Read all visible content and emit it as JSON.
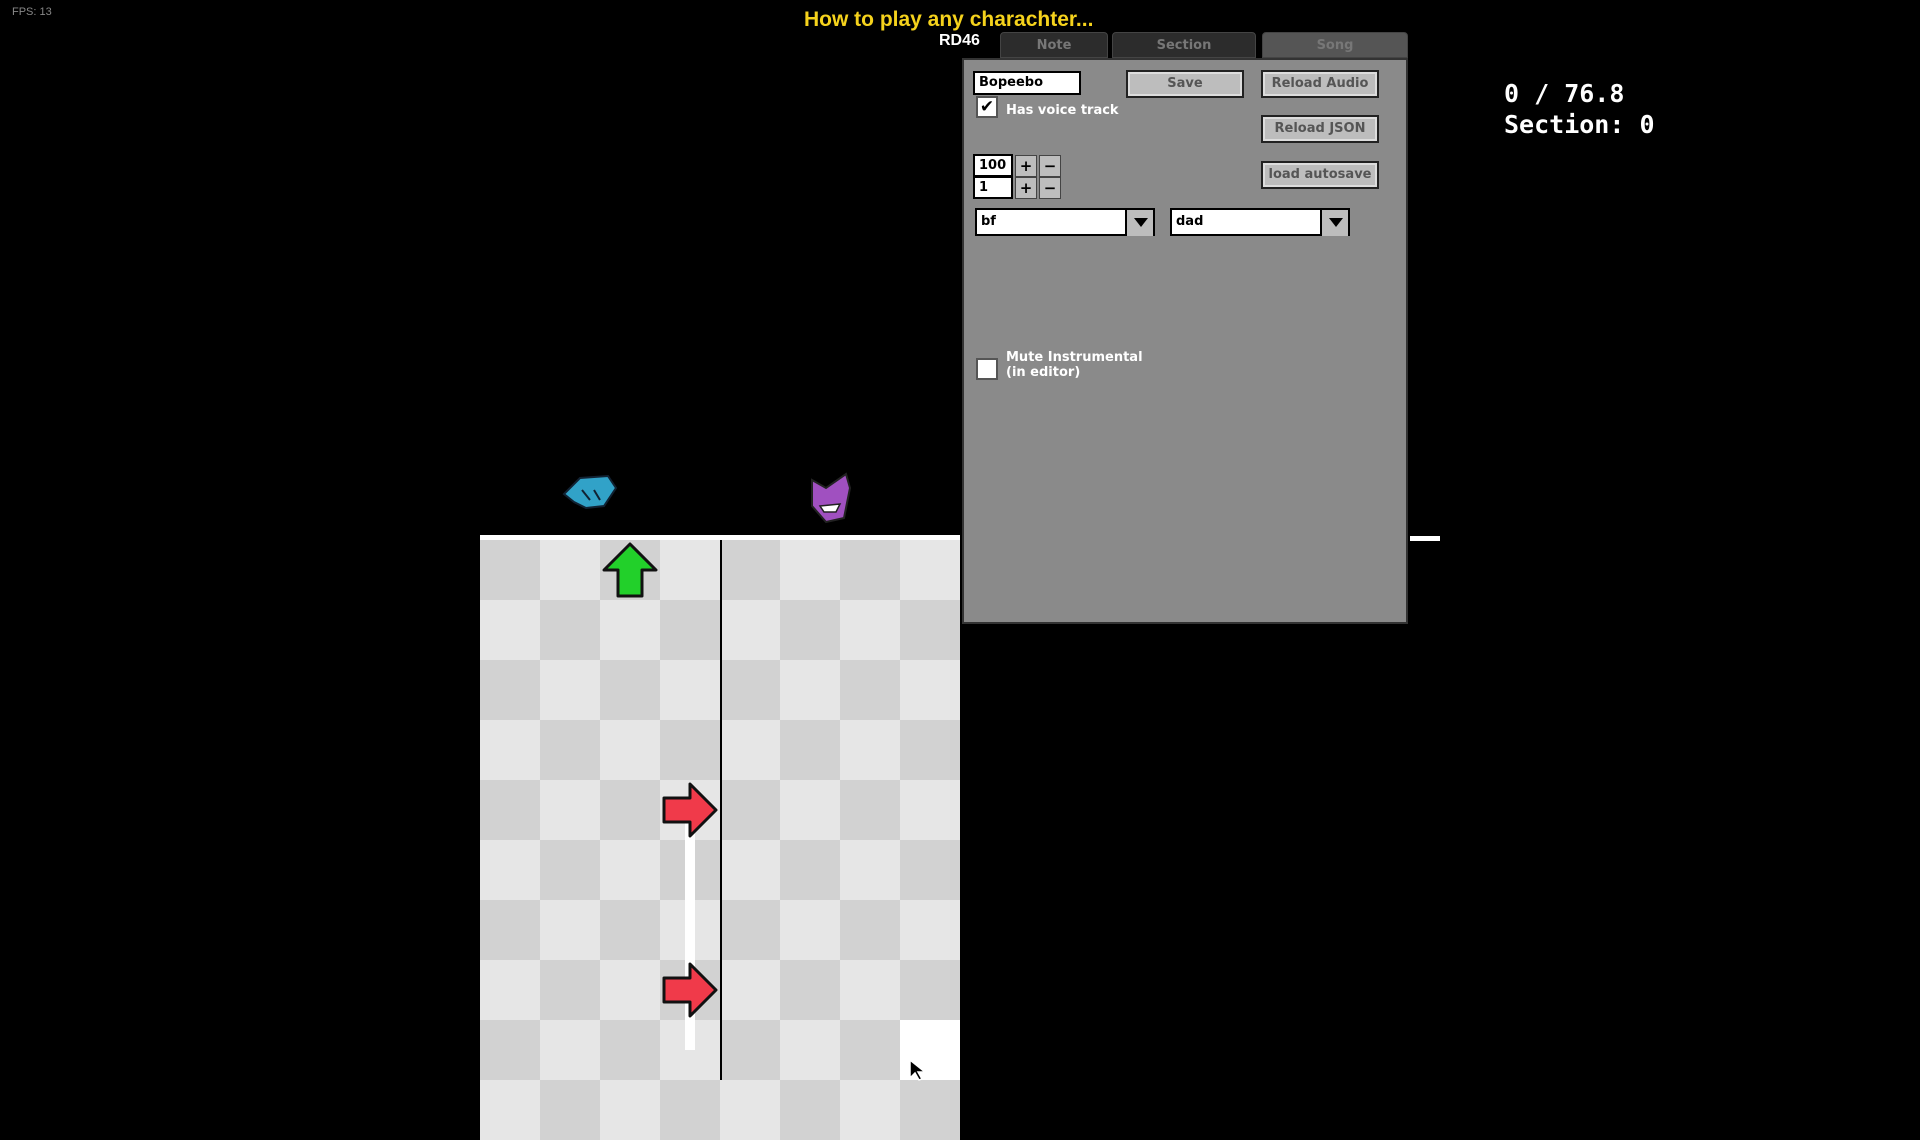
{
  "fps": "FPS: 13",
  "song_title": "How to play any charachter...",
  "author": "RD46",
  "tabs": [
    {
      "label": "Note"
    },
    {
      "label": "Section"
    },
    {
      "label": "Song",
      "active": true
    }
  ],
  "song": {
    "name": "Bopeebo",
    "save_label": "Save",
    "reload_audio_label": "Reload Audio",
    "reload_json_label": "Reload JSON",
    "load_autosave_label": "load autosave",
    "has_voice_track_label": "Has voice track",
    "has_voice_track": true,
    "bpm": "100",
    "speed": "1",
    "plus": "+",
    "minus": "−",
    "player1": "bf",
    "player2": "dad",
    "mute_label_1": "Mute Instrumental",
    "mute_label_2": "(in editor)",
    "mute_instrumental": false
  },
  "info": {
    "time": "0 / 76.8",
    "section": "Section: 0"
  },
  "colors": {
    "title": "#f5d21c",
    "panel": "#8a8a8a",
    "grid_light": "#e6e6e6",
    "grid_dark": "#d2d2d2",
    "up_note": "#22d02a",
    "right_note": "#f03a4a",
    "bf_icon": "#31a2c8",
    "dad_icon": "#a050c0"
  },
  "notes": [
    {
      "lane": 2,
      "row": 0,
      "direction": "up"
    },
    {
      "lane": 3,
      "row": 4,
      "direction": "right",
      "sustain_rows": 4
    },
    {
      "lane": 3,
      "row": 7,
      "direction": "right"
    }
  ]
}
